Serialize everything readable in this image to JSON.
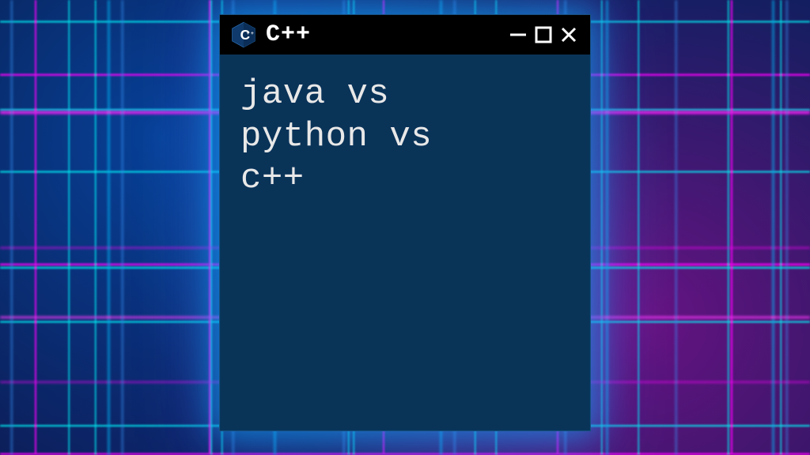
{
  "window": {
    "title": "C++",
    "icon_name": "cpp-icon",
    "content": {
      "line1": "java vs",
      "line2": "python vs",
      "line3": "c++"
    }
  },
  "colors": {
    "window_bg": "#0a3358",
    "titlebar_bg": "#000000",
    "text": "#e8e8e8",
    "glow": "#00b4ff"
  }
}
